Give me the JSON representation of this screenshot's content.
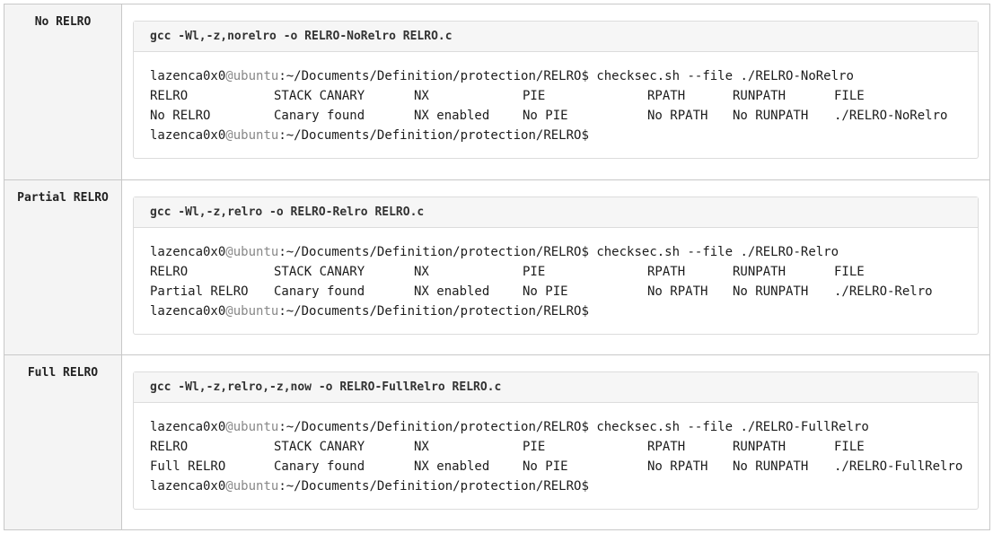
{
  "rows": [
    {
      "label": "No RELRO",
      "compile_cmd": "gcc -Wl,-z,norelro -o RELRO-NoRelro RELRO.c",
      "prompt": {
        "user": "lazenca0x0",
        "at": "@",
        "host": "ubuntu",
        "path": ":~/Documents/Definition/protection/RELRO$"
      },
      "command": " checksec.sh --file ./RELRO-NoRelro",
      "header": [
        "RELRO",
        "STACK CANARY",
        "NX",
        "PIE",
        "RPATH",
        "RUNPATH",
        "FILE"
      ],
      "values": [
        "No RELRO",
        "Canary found",
        "NX enabled",
        "No PIE",
        "No RPATH",
        "No RUNPATH",
        "./RELRO-NoRelro"
      ]
    },
    {
      "label": "Partial RELRO",
      "compile_cmd": "gcc -Wl,-z,relro -o RELRO-Relro RELRO.c",
      "prompt": {
        "user": "lazenca0x0",
        "at": "@",
        "host": "ubuntu",
        "path": ":~/Documents/Definition/protection/RELRO$"
      },
      "command": " checksec.sh --file ./RELRO-Relro",
      "header": [
        "RELRO",
        "STACK CANARY",
        "NX",
        "PIE",
        "RPATH",
        "RUNPATH",
        "FILE"
      ],
      "values": [
        "Partial RELRO",
        "Canary found",
        "NX enabled",
        "No PIE",
        "No RPATH",
        "No RUNPATH",
        "./RELRO-Relro"
      ]
    },
    {
      "label": "Full RELRO",
      "compile_cmd": "gcc -Wl,-z,relro,-z,now -o RELRO-FullRelro RELRO.c",
      "prompt": {
        "user": "lazenca0x0",
        "at": "@",
        "host": "ubuntu",
        "path": ":~/Documents/Definition/protection/RELRO$"
      },
      "command": " checksec.sh --file ./RELRO-FullRelro",
      "header": [
        "RELRO",
        "STACK CANARY",
        "NX",
        "PIE",
        "RPATH",
        "RUNPATH",
        "FILE"
      ],
      "values": [
        "Full RELRO",
        "Canary found",
        "NX enabled",
        "No PIE",
        "No RPATH",
        "No RUNPATH",
        "./RELRO-FullRelro"
      ]
    }
  ]
}
